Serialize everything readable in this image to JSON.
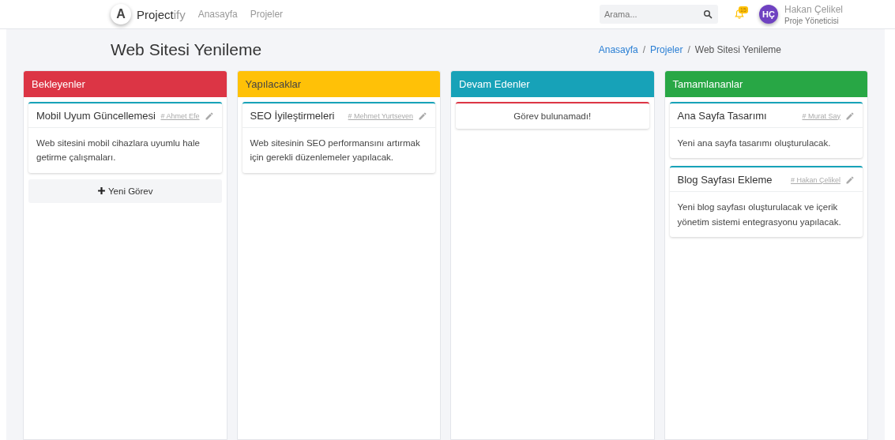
{
  "navbar": {
    "logo_letter": "A",
    "brand": "Project",
    "brand_suffix": "ify",
    "links": [
      "Anasayfa",
      "Projeler"
    ],
    "search": {
      "placeholder": "Arama..."
    },
    "notifications": "15",
    "user": {
      "initials": "HÇ",
      "name": "Hakan Çelikel",
      "role": "Proje Yöneticisi"
    }
  },
  "page": {
    "title": "Web Sitesi Yenileme",
    "breadcrumb_separator": "/",
    "breadcrumb": [
      {
        "label": "Anasayfa",
        "kind": "link"
      },
      {
        "label": "Projeler",
        "kind": "link"
      },
      {
        "label": "Web Sitesi Yenileme",
        "kind": "current"
      }
    ]
  },
  "columns": [
    {
      "title": "Bekleyenler",
      "color": "#dc3545",
      "cards": [
        {
          "kind": "task",
          "title": "Mobil Uyum Güncellemesi",
          "assignee": "# Ahmet Efe",
          "description": "Web sitesini mobil cihazlara uyumlu hale getirme çalışmaları.",
          "color": "#17a2b8"
        }
      ],
      "add_button": "Yeni Görev"
    },
    {
      "title": "Yapılacaklar",
      "color": "#ffc107",
      "cards": [
        {
          "kind": "task",
          "title": "SEO İyileştirmeleri",
          "assignee": "# Mehmet Yurtseven",
          "description": "Web sitesinin SEO performansını artırmak için gerekli düzenlemeler yapılacak.",
          "color": "#17a2b8"
        }
      ]
    },
    {
      "title": "Devam Edenler",
      "color": "#17a2b8",
      "cards": [
        {
          "kind": "empty",
          "message": "Görev bulunamadı!",
          "color": "#dc3545"
        }
      ]
    },
    {
      "title": "Tamamlananlar",
      "color": "#28a745",
      "cards": [
        {
          "kind": "task",
          "title": "Ana Sayfa Tasarımı",
          "assignee": "# Murat Say",
          "description": "Yeni ana sayfa tasarımı oluşturulacak.",
          "color": "#17a2b8"
        },
        {
          "kind": "task",
          "title": "Blog Sayfası Ekleme",
          "assignee": "# Hakan Çelikel",
          "description": "Yeni blog sayfası oluşturulacak ve içerik yönetim sistemi entegrasyonu yapılacak.",
          "color": "#17a2b8"
        }
      ]
    }
  ]
}
